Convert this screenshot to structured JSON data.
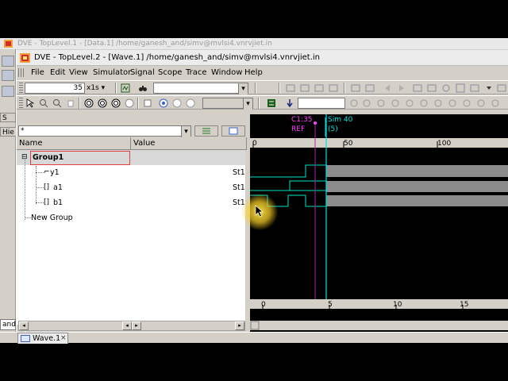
{
  "bg_window": {
    "title": "DVE - TopLevel.1 - [Data.1] /home/ganesh_and/simv@mvlsi4.vnrvjiet.in"
  },
  "window": {
    "title": "DVE - TopLevel.2 - [Wave.1] /home/ganesh_and/simv@mvlsi4.vnrvjiet.in"
  },
  "menu": [
    "File",
    "Edit",
    "View",
    "Simulator",
    "Signal",
    "Scope",
    "Trace",
    "Window",
    "Help"
  ],
  "menu_underline": [
    "F",
    "E",
    "V",
    "S",
    "g",
    "S",
    "T",
    "W",
    "H"
  ],
  "toolbar1": {
    "time_value": "35",
    "time_unit": "x1s",
    "scope_value": ""
  },
  "filter": {
    "value": "*"
  },
  "columns": {
    "name": "Name",
    "value": "Value"
  },
  "tree": {
    "group": "Group1",
    "signals": [
      {
        "name": "y1",
        "value": "St1",
        "icon": "wave-icon"
      },
      {
        "name": "a1",
        "value": "St1",
        "icon": "bus-icon"
      },
      {
        "name": "b1",
        "value": "St1",
        "icon": "bus-icon"
      }
    ],
    "new_group": "New Group"
  },
  "sidebar_labels": {
    "hier": "Hie",
    "s": "S"
  },
  "wave": {
    "cursor_label": "C1:35",
    "ref_label": "REF",
    "sim_label": "Sim 40",
    "sim_sub": "(5)",
    "top_ticks": [
      "0",
      "50",
      "100"
    ],
    "bottom_ticks": [
      "0",
      "5",
      "10",
      "15"
    ],
    "colors": {
      "signal": "#00e0c0",
      "cursor": "#00e0e0",
      "marker": "#ff40ff",
      "bar": "#8c8c8c"
    }
  },
  "bottom_input": "and",
  "tab": {
    "label": "Wave.1",
    "close": "×"
  }
}
